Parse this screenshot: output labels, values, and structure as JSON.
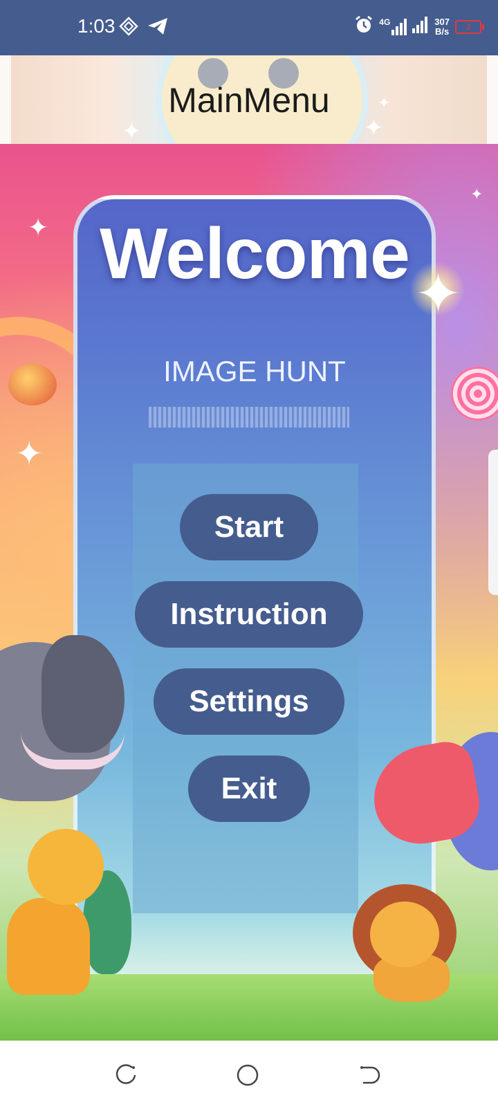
{
  "status_bar": {
    "time": "1:03",
    "network": "4G",
    "speed_value": "307",
    "speed_unit": "B/s",
    "battery_level": "2",
    "icons": [
      "navigation-diamond-icon",
      "telegram-icon",
      "alarm-icon",
      "signal-4g-icon",
      "signal-bars-icon",
      "battery-low-icon"
    ],
    "background": "#455c8e"
  },
  "header": {
    "title": "MainMenu"
  },
  "art": {
    "welcome_text": "Welcome",
    "subtitle_text": "IMAGE HUNT"
  },
  "menu": {
    "start_label": "Start",
    "instruction_label": "Instruction",
    "settings_label": "Settings",
    "exit_label": "Exit",
    "button_color": "#455c8e"
  },
  "nav_bar": {
    "icons": [
      "recent-apps-icon",
      "home-icon",
      "back-icon"
    ]
  }
}
